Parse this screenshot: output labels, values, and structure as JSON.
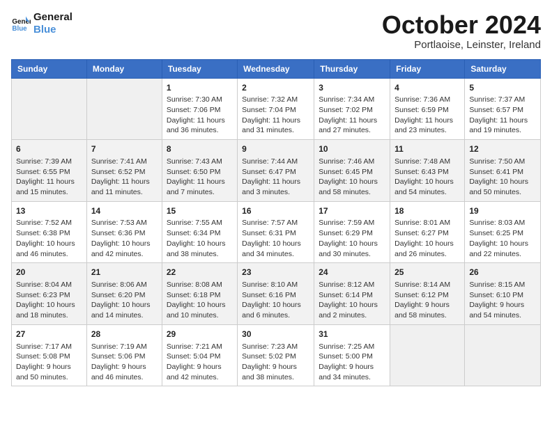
{
  "header": {
    "logo_line1": "General",
    "logo_line2": "Blue",
    "month_title": "October 2024",
    "location": "Portlaoise, Leinster, Ireland"
  },
  "days_of_week": [
    "Sunday",
    "Monday",
    "Tuesday",
    "Wednesday",
    "Thursday",
    "Friday",
    "Saturday"
  ],
  "weeks": [
    [
      {
        "day": "",
        "empty": true
      },
      {
        "day": "",
        "empty": true
      },
      {
        "day": "1",
        "sunrise": "Sunrise: 7:30 AM",
        "sunset": "Sunset: 7:06 PM",
        "daylight": "Daylight: 11 hours and 36 minutes."
      },
      {
        "day": "2",
        "sunrise": "Sunrise: 7:32 AM",
        "sunset": "Sunset: 7:04 PM",
        "daylight": "Daylight: 11 hours and 31 minutes."
      },
      {
        "day": "3",
        "sunrise": "Sunrise: 7:34 AM",
        "sunset": "Sunset: 7:02 PM",
        "daylight": "Daylight: 11 hours and 27 minutes."
      },
      {
        "day": "4",
        "sunrise": "Sunrise: 7:36 AM",
        "sunset": "Sunset: 6:59 PM",
        "daylight": "Daylight: 11 hours and 23 minutes."
      },
      {
        "day": "5",
        "sunrise": "Sunrise: 7:37 AM",
        "sunset": "Sunset: 6:57 PM",
        "daylight": "Daylight: 11 hours and 19 minutes."
      }
    ],
    [
      {
        "day": "6",
        "sunrise": "Sunrise: 7:39 AM",
        "sunset": "Sunset: 6:55 PM",
        "daylight": "Daylight: 11 hours and 15 minutes."
      },
      {
        "day": "7",
        "sunrise": "Sunrise: 7:41 AM",
        "sunset": "Sunset: 6:52 PM",
        "daylight": "Daylight: 11 hours and 11 minutes."
      },
      {
        "day": "8",
        "sunrise": "Sunrise: 7:43 AM",
        "sunset": "Sunset: 6:50 PM",
        "daylight": "Daylight: 11 hours and 7 minutes."
      },
      {
        "day": "9",
        "sunrise": "Sunrise: 7:44 AM",
        "sunset": "Sunset: 6:47 PM",
        "daylight": "Daylight: 11 hours and 3 minutes."
      },
      {
        "day": "10",
        "sunrise": "Sunrise: 7:46 AM",
        "sunset": "Sunset: 6:45 PM",
        "daylight": "Daylight: 10 hours and 58 minutes."
      },
      {
        "day": "11",
        "sunrise": "Sunrise: 7:48 AM",
        "sunset": "Sunset: 6:43 PM",
        "daylight": "Daylight: 10 hours and 54 minutes."
      },
      {
        "day": "12",
        "sunrise": "Sunrise: 7:50 AM",
        "sunset": "Sunset: 6:41 PM",
        "daylight": "Daylight: 10 hours and 50 minutes."
      }
    ],
    [
      {
        "day": "13",
        "sunrise": "Sunrise: 7:52 AM",
        "sunset": "Sunset: 6:38 PM",
        "daylight": "Daylight: 10 hours and 46 minutes."
      },
      {
        "day": "14",
        "sunrise": "Sunrise: 7:53 AM",
        "sunset": "Sunset: 6:36 PM",
        "daylight": "Daylight: 10 hours and 42 minutes."
      },
      {
        "day": "15",
        "sunrise": "Sunrise: 7:55 AM",
        "sunset": "Sunset: 6:34 PM",
        "daylight": "Daylight: 10 hours and 38 minutes."
      },
      {
        "day": "16",
        "sunrise": "Sunrise: 7:57 AM",
        "sunset": "Sunset: 6:31 PM",
        "daylight": "Daylight: 10 hours and 34 minutes."
      },
      {
        "day": "17",
        "sunrise": "Sunrise: 7:59 AM",
        "sunset": "Sunset: 6:29 PM",
        "daylight": "Daylight: 10 hours and 30 minutes."
      },
      {
        "day": "18",
        "sunrise": "Sunrise: 8:01 AM",
        "sunset": "Sunset: 6:27 PM",
        "daylight": "Daylight: 10 hours and 26 minutes."
      },
      {
        "day": "19",
        "sunrise": "Sunrise: 8:03 AM",
        "sunset": "Sunset: 6:25 PM",
        "daylight": "Daylight: 10 hours and 22 minutes."
      }
    ],
    [
      {
        "day": "20",
        "sunrise": "Sunrise: 8:04 AM",
        "sunset": "Sunset: 6:23 PM",
        "daylight": "Daylight: 10 hours and 18 minutes."
      },
      {
        "day": "21",
        "sunrise": "Sunrise: 8:06 AM",
        "sunset": "Sunset: 6:20 PM",
        "daylight": "Daylight: 10 hours and 14 minutes."
      },
      {
        "day": "22",
        "sunrise": "Sunrise: 8:08 AM",
        "sunset": "Sunset: 6:18 PM",
        "daylight": "Daylight: 10 hours and 10 minutes."
      },
      {
        "day": "23",
        "sunrise": "Sunrise: 8:10 AM",
        "sunset": "Sunset: 6:16 PM",
        "daylight": "Daylight: 10 hours and 6 minutes."
      },
      {
        "day": "24",
        "sunrise": "Sunrise: 8:12 AM",
        "sunset": "Sunset: 6:14 PM",
        "daylight": "Daylight: 10 hours and 2 minutes."
      },
      {
        "day": "25",
        "sunrise": "Sunrise: 8:14 AM",
        "sunset": "Sunset: 6:12 PM",
        "daylight": "Daylight: 9 hours and 58 minutes."
      },
      {
        "day": "26",
        "sunrise": "Sunrise: 8:15 AM",
        "sunset": "Sunset: 6:10 PM",
        "daylight": "Daylight: 9 hours and 54 minutes."
      }
    ],
    [
      {
        "day": "27",
        "sunrise": "Sunrise: 7:17 AM",
        "sunset": "Sunset: 5:08 PM",
        "daylight": "Daylight: 9 hours and 50 minutes."
      },
      {
        "day": "28",
        "sunrise": "Sunrise: 7:19 AM",
        "sunset": "Sunset: 5:06 PM",
        "daylight": "Daylight: 9 hours and 46 minutes."
      },
      {
        "day": "29",
        "sunrise": "Sunrise: 7:21 AM",
        "sunset": "Sunset: 5:04 PM",
        "daylight": "Daylight: 9 hours and 42 minutes."
      },
      {
        "day": "30",
        "sunrise": "Sunrise: 7:23 AM",
        "sunset": "Sunset: 5:02 PM",
        "daylight": "Daylight: 9 hours and 38 minutes."
      },
      {
        "day": "31",
        "sunrise": "Sunrise: 7:25 AM",
        "sunset": "Sunset: 5:00 PM",
        "daylight": "Daylight: 9 hours and 34 minutes."
      },
      {
        "day": "",
        "empty": true
      },
      {
        "day": "",
        "empty": true
      }
    ]
  ]
}
